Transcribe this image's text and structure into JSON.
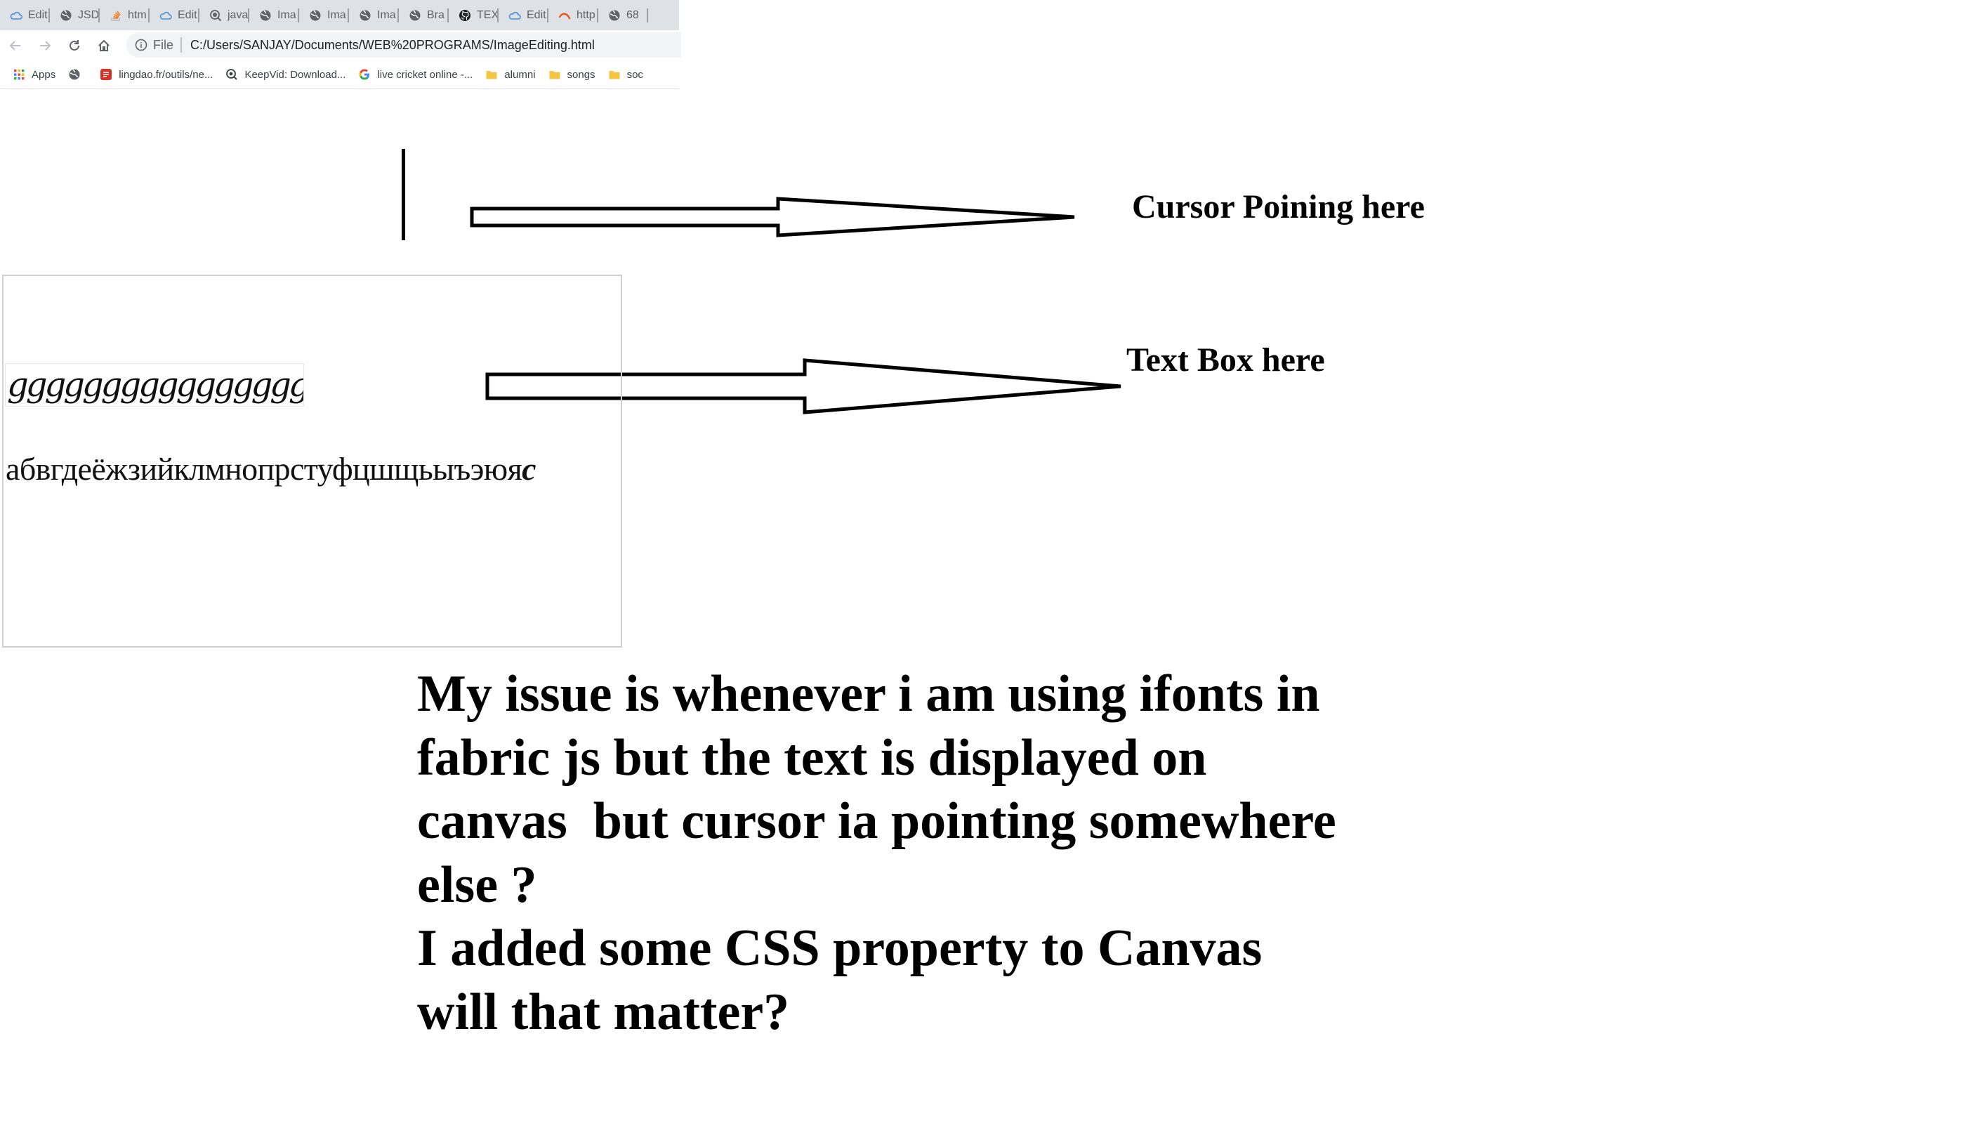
{
  "browser": {
    "tabs": [
      {
        "label": "Edit",
        "icon": "cloud-icon"
      },
      {
        "label": "JSD",
        "icon": "globe-icon"
      },
      {
        "label": "htm",
        "icon": "stackoverflow-icon"
      },
      {
        "label": "Edit",
        "icon": "cloud-icon"
      },
      {
        "label": "java",
        "icon": "search-globe-icon"
      },
      {
        "label": "Ima",
        "icon": "globe-icon"
      },
      {
        "label": "Ima",
        "icon": "globe-icon"
      },
      {
        "label": "Ima",
        "icon": "globe-icon"
      },
      {
        "label": "Bra",
        "icon": "globe-icon"
      },
      {
        "label": "TEX",
        "icon": "github-icon"
      },
      {
        "label": "Edit",
        "icon": "cloud-icon"
      },
      {
        "label": "http",
        "icon": "swoosh-icon"
      },
      {
        "label": "68",
        "icon": "globe-icon"
      }
    ],
    "omnibox": {
      "scheme_label": "File",
      "url": "C:/Users/SANJAY/Documents/WEB%20PROGRAMS/ImageEditing.html"
    },
    "bookmarks": [
      {
        "label": "Apps",
        "icon": "apps-grid-icon"
      },
      {
        "label": "",
        "icon": "globe-icon"
      },
      {
        "label": "lingdao.fr/outils/ne...",
        "icon": "red-square-icon"
      },
      {
        "label": "KeepVid: Download...",
        "icon": "keepvid-icon"
      },
      {
        "label": "live cricket online -...",
        "icon": "google-icon"
      },
      {
        "label": "alumni",
        "icon": "folder-icon"
      },
      {
        "label": "songs",
        "icon": "folder-icon"
      },
      {
        "label": "soc",
        "icon": "folder-icon"
      }
    ]
  },
  "annotations": {
    "cursor_label": "Cursor Poining here",
    "textbox_label": "Text Box here"
  },
  "canvas": {
    "itext_value": "ggggggggggggggggggc",
    "cyrillic_main": "абвгдеёжзийклмнопрстуфцшщьыъэюя",
    "cyrillic_end": "c"
  },
  "question": {
    "lines": [
      "My issue is whenever i am using ifonts in",
      "fabric js but the text is displayed on",
      "canvas  but cursor ia pointing somewhere",
      "else ?",
      "I added some CSS property to Canvas",
      "will that matter?"
    ]
  },
  "colors": {
    "tabstrip_bg": "#dee1e6",
    "omnibox_bg": "#f1f3f4",
    "folder": "#f5c542",
    "text": "#000000"
  }
}
